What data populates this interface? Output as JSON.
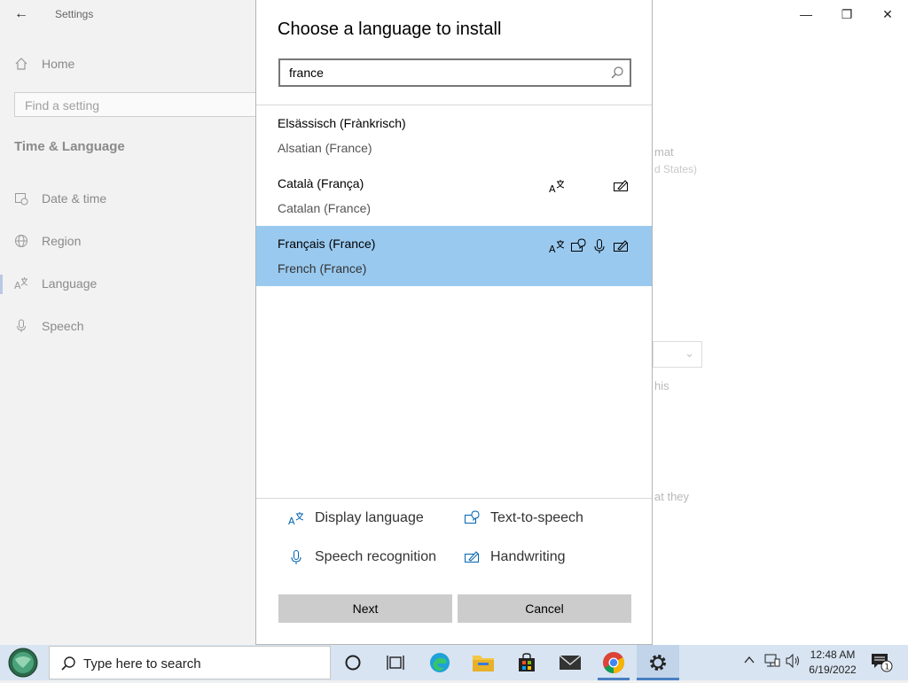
{
  "settings": {
    "app_title": "Settings",
    "home_label": "Home",
    "search_placeholder": "Find a setting",
    "section_title": "Time & Language",
    "nav": [
      {
        "label": "Date & time"
      },
      {
        "label": "Region"
      },
      {
        "label": "Language"
      },
      {
        "label": "Speech"
      }
    ],
    "background_fragments": {
      "format_text": "mat",
      "region_text": "d States)",
      "this_text": "his",
      "they_text": "at they"
    }
  },
  "dialog": {
    "title": "Choose a language to install",
    "search_value": "france",
    "languages": [
      {
        "native": "Elsässisch (Frànkrisch)",
        "english": "Alsatian (France)",
        "features": []
      },
      {
        "native": "Català (França)",
        "english": "Catalan (France)",
        "features": [
          "display-language",
          "handwriting"
        ]
      },
      {
        "native": "Français (France)",
        "english": "French (France)",
        "features": [
          "display-language",
          "text-to-speech",
          "speech-recognition",
          "handwriting"
        ],
        "selected": true
      }
    ],
    "legend": {
      "display_language": "Display language",
      "text_to_speech": "Text-to-speech",
      "speech_recognition": "Speech recognition",
      "handwriting": "Handwriting"
    },
    "next_label": "Next",
    "cancel_label": "Cancel"
  },
  "taskbar": {
    "search_placeholder": "Type here to search",
    "time": "12:48 AM",
    "date": "6/19/2022",
    "notification_count": "1"
  },
  "colors": {
    "selected_row": "#99c9ef",
    "accent": "#0063b1",
    "button_bg": "#cccccc",
    "taskbar_bg": "#d8e4f2"
  }
}
